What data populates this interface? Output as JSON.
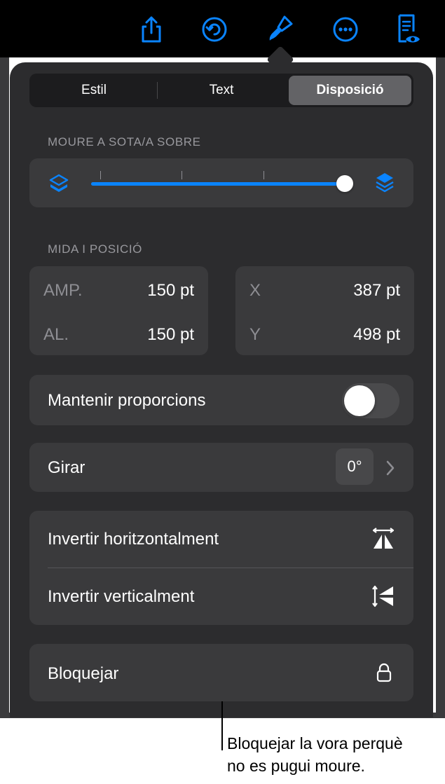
{
  "toolbar": {
    "buttons": [
      {
        "name": "share-icon"
      },
      {
        "name": "undo-icon"
      },
      {
        "name": "format-brush-icon"
      },
      {
        "name": "more-icon"
      },
      {
        "name": "reading-view-icon"
      }
    ],
    "accent": "#0a84ff"
  },
  "tabs": [
    {
      "label": "Estil",
      "active": false
    },
    {
      "label": "Text",
      "active": false
    },
    {
      "label": "Disposició",
      "active": true
    }
  ],
  "arrange": {
    "section_label": "MOURE A SOTA/A SOBRE",
    "left_icon": "send-to-back-icon",
    "right_icon": "bring-to-front-icon",
    "slider_value": 1.0
  },
  "size_position": {
    "section_label": "MIDA I POSICIÓ",
    "width_label": "AMP.",
    "width_value": "150 pt",
    "height_label": "AL.",
    "height_value": "150 pt",
    "x_label": "X",
    "x_value": "387 pt",
    "y_label": "Y",
    "y_value": "498 pt"
  },
  "proportions": {
    "label": "Mantenir proporcions",
    "on": false
  },
  "rotate": {
    "label": "Girar",
    "value": "0°"
  },
  "flip": {
    "horizontal_label": "Invertir horitzontalment",
    "vertical_label": "Invertir verticalment"
  },
  "lock": {
    "label": "Bloquejar"
  },
  "callout": {
    "line1": "Bloquejar la vora perquè",
    "line2": "no es pugui moure."
  }
}
